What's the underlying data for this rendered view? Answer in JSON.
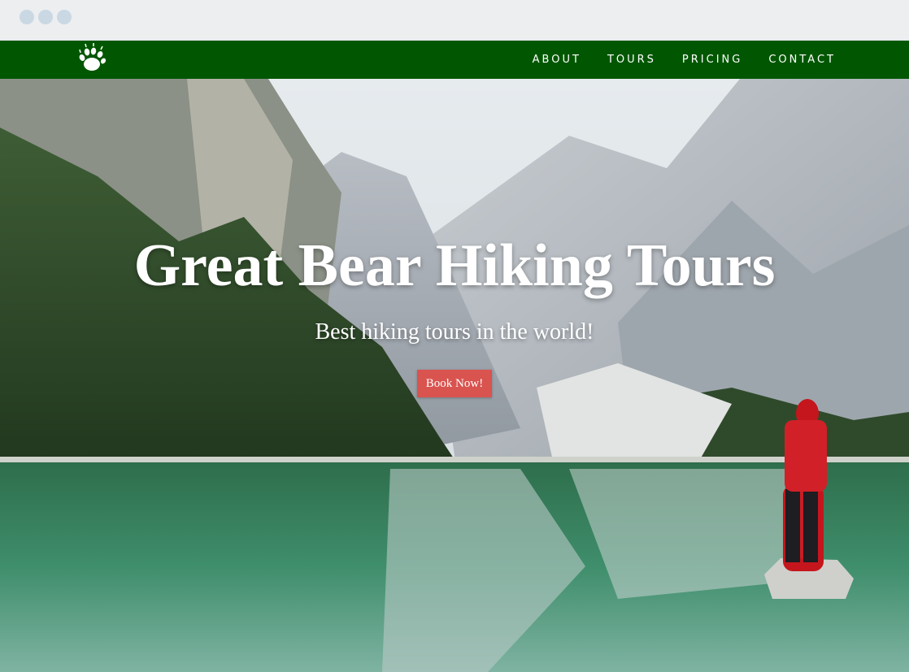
{
  "nav": {
    "logo_icon": "bear-paw-icon",
    "links": [
      "ABOUT",
      "TOURS",
      "PRICING",
      "CONTACT"
    ]
  },
  "hero": {
    "title": "Great Bear Hiking Tours",
    "subtitle": "Best hiking tours in the world!",
    "cta_label": "Book Now!"
  },
  "colors": {
    "nav_background": "#015701",
    "cta_background": "#d9534f",
    "text": "#ffffff"
  }
}
